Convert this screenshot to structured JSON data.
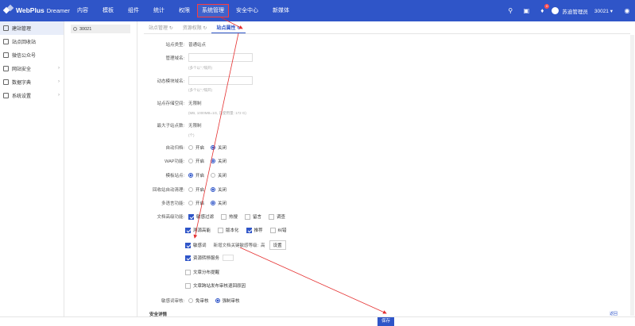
{
  "app": {
    "name": "WebPlus",
    "edition": "Dreamer"
  },
  "nav": [
    "内容",
    "模板",
    "组件",
    "统计",
    "权限",
    "系统管理",
    "安全中心",
    "新媒体"
  ],
  "header": {
    "notification_count": "0",
    "user": "苏迪管理员",
    "site_selector": "30021 ▾"
  },
  "sidebar": {
    "items": [
      {
        "label": "建站管理",
        "icon": "site-icon"
      },
      {
        "label": "站点回收站",
        "icon": "recycle-icon"
      },
      {
        "label": "微信公众号",
        "icon": "wechat-icon"
      },
      {
        "label": "网站安全",
        "icon": "shield-icon"
      },
      {
        "label": "数据字典",
        "icon": "dictionary-icon"
      },
      {
        "label": "系统设置",
        "icon": "settings-icon"
      }
    ]
  },
  "tree": {
    "site": "30021"
  },
  "tabs": [
    "站点管理",
    "资源权限",
    "站点属性"
  ],
  "form": {
    "site_type_label": "站点类型:",
    "site_type_value": "普通站点",
    "admin_domain_label": "管理域名:",
    "admin_domain_hint": "(多个以\",\"隔开)",
    "dynamic_domain_label": "动态模块域名:",
    "dynamic_domain_hint": "(多个以\",\"隔开)",
    "storage_label": "站点存储空间:",
    "storage_value": "无限制",
    "storage_hint": "(MB, 1000MB=1G, 已使用量: 172 G)",
    "max_child_label": "最大子站点数:",
    "max_child_value": "无限制",
    "max_child_hint": "(个)",
    "auto_archive_label": "自动归档:",
    "wap_label": "WAP功能:",
    "template_site_label": "模板站点:",
    "recycle_label": "回收站自动清理:",
    "multi_lang_label": "多语言功能:",
    "doc_adv_label": "文档高级功能:",
    "on": "开启",
    "off": "关闭",
    "opt_sensitive_filter": "敏感过滤",
    "opt_hot": "热搜",
    "opt_comment": "留言",
    "opt_survey": "调查",
    "opt_source_trace": "溯源高能",
    "opt_version": "版本化",
    "opt_recommend": "推荐",
    "opt_correct": "纠错",
    "opt_sensitive_word": "敏感词",
    "sensitive_level_label": "新增文档关键敏感等级:",
    "sensitive_level_value": "高",
    "set_button": "设置",
    "opt_resource_sync": "资源转移服务",
    "opt_doc_remind": "文章分布提醒",
    "opt_doc_push": "文章跨站发布审核退回原因",
    "review_label": "敏感词审核:",
    "review_opt1": "免审核",
    "review_opt2": "强制审核",
    "section_cut_label": "安全详情",
    "section_cut_link": "返回",
    "save_button": "保存"
  },
  "colors": {
    "accent": "#2f55c8",
    "highlight": "#ff3b3b"
  }
}
